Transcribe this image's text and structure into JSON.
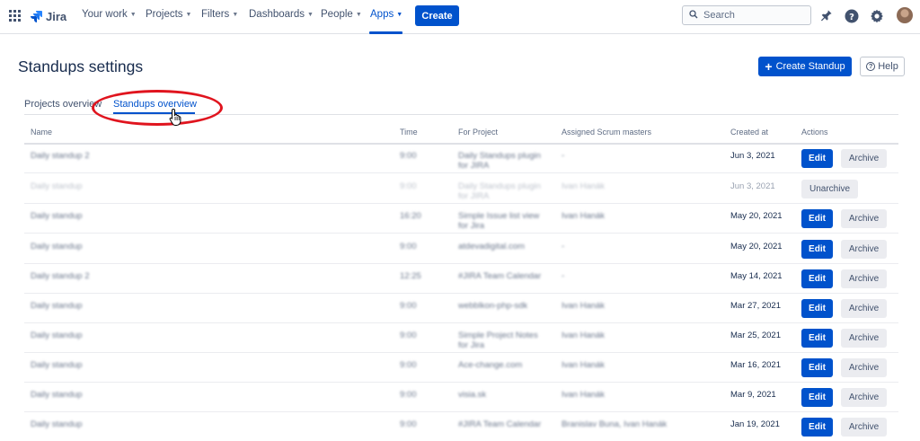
{
  "topnav": {
    "logo_text": "Jira",
    "menu": [
      {
        "label": "Your work"
      },
      {
        "label": "Projects"
      },
      {
        "label": "Filters"
      },
      {
        "label": "Dashboards"
      },
      {
        "label": "People"
      },
      {
        "label": "Apps",
        "active": true
      }
    ],
    "create_label": "Create",
    "search_placeholder": "Search",
    "icons": [
      "apps-grid-icon",
      "jira-logo-icon",
      "search-icon",
      "notifications-icon",
      "help-icon",
      "settings-icon",
      "avatar"
    ]
  },
  "page": {
    "title": "Standups settings",
    "create_standup_label": "Create Standup",
    "help_label": "Help"
  },
  "tabs": [
    {
      "label": "Projects overview",
      "active": false
    },
    {
      "label": "Standups overview",
      "active": true
    }
  ],
  "table": {
    "headers": [
      "Name",
      "Time",
      "For Project",
      "Assigned Scrum masters",
      "Created at",
      "Actions"
    ],
    "rows": [
      {
        "name": "Daily standup 2",
        "time": "9:00",
        "project": "Daily Standups plugin for JIRA",
        "scrum_masters": "-",
        "created": "Jun 3, 2021",
        "archived": false
      },
      {
        "name": "Daily standup",
        "time": "9:00",
        "project": "Daily Standups plugin for JIRA",
        "scrum_masters": "Ivan Hanák",
        "created": "Jun 3, 2021",
        "archived": true
      },
      {
        "name": "Daily standup",
        "time": "16:20",
        "project": "Simple Issue list view for Jira",
        "scrum_masters": "Ivan Hanák",
        "created": "May 20, 2021",
        "archived": false
      },
      {
        "name": "Daily standup",
        "time": "9:00",
        "project": "atdevadigital.com",
        "scrum_masters": "-",
        "created": "May 20, 2021",
        "archived": false
      },
      {
        "name": "Daily standup 2",
        "time": "12:25",
        "project": "#JIRA Team Calendar",
        "scrum_masters": "-",
        "created": "May 14, 2021",
        "archived": false
      },
      {
        "name": "Daily standup",
        "time": "9:00",
        "project": "webblkon-php-sdk",
        "scrum_masters": "Ivan Hanák",
        "created": "Mar 27, 2021",
        "archived": false
      },
      {
        "name": "Daily standup",
        "time": "9:00",
        "project": "Simple Project Notes for Jira",
        "scrum_masters": "Ivan Hanák",
        "created": "Mar 25, 2021",
        "archived": false
      },
      {
        "name": "Daily standup",
        "time": "9:00",
        "project": "Ace-change.com",
        "scrum_masters": "Ivan Hanák",
        "created": "Mar 16, 2021",
        "archived": false
      },
      {
        "name": "Daily standup",
        "time": "9:00",
        "project": "visia.sk",
        "scrum_masters": "Ivan Hanák",
        "created": "Mar 9, 2021",
        "archived": false
      },
      {
        "name": "Daily standup",
        "time": "9:00",
        "project": "#JIRA Team Calendar",
        "scrum_masters": "Branislav Buna, Ivan Hanák",
        "created": "Jan 19, 2021",
        "archived": false
      }
    ],
    "actions": {
      "edit": "Edit",
      "archive": "Archive",
      "unarchive": "Unarchive"
    }
  },
  "colors": {
    "primary": "#0052cc",
    "highlight_annotation": "#e0141e"
  }
}
